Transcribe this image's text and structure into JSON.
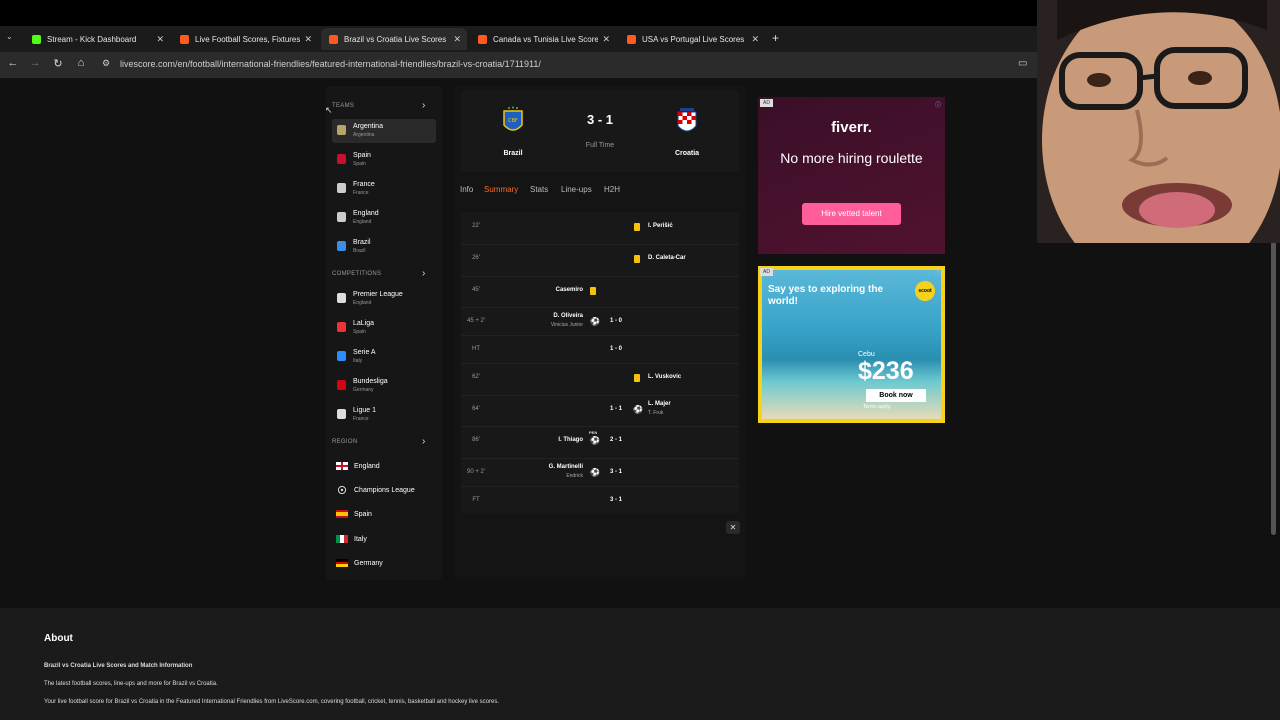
{
  "browser": {
    "tabs": [
      {
        "title": "Stream - Kick Dashboard",
        "favicon_color": "#53fc18"
      },
      {
        "title": "Live Football Scores, Fixtures &",
        "favicon_color": "#ff5a1f"
      },
      {
        "title": "Brazil vs Croatia Live Scores | Li",
        "favicon_color": "#ff5a1f"
      },
      {
        "title": "Canada vs Tunisia Live Scores |",
        "favicon_color": "#ff5a1f"
      },
      {
        "title": "USA vs Portugal Live Scores | Li",
        "favicon_color": "#ff5a1f"
      }
    ],
    "active_tab": 2,
    "url": "livescore.com/en/football/international-friendlies/featured-international-friendlies/brazil-vs-croatia/1711911/"
  },
  "sidebar": {
    "teams_title": "TEAMS",
    "teams": [
      {
        "name": "Argentina",
        "sub": "Argentina",
        "color": "#b9a36b"
      },
      {
        "name": "Spain",
        "sub": "Spain",
        "color": "#c8102e"
      },
      {
        "name": "France",
        "sub": "France",
        "color": "#ccc"
      },
      {
        "name": "England",
        "sub": "England",
        "color": "#ccc"
      },
      {
        "name": "Brazil",
        "sub": "Brazil",
        "color": "#3a8ee6"
      }
    ],
    "competitions_title": "COMPETITIONS",
    "competitions": [
      {
        "name": "Premier League",
        "sub": "England",
        "color": "#ddd"
      },
      {
        "name": "LaLiga",
        "sub": "Spain",
        "color": "#ee3338"
      },
      {
        "name": "Serie A",
        "sub": "Italy",
        "color": "#2f8cff"
      },
      {
        "name": "Bundesliga",
        "sub": "Germany",
        "color": "#d20515"
      },
      {
        "name": "Ligue 1",
        "sub": "France",
        "color": "#ddd"
      }
    ],
    "region_title": "REGION",
    "regions": [
      {
        "name": "England"
      },
      {
        "name": "Champions League"
      },
      {
        "name": "Spain"
      },
      {
        "name": "Italy"
      },
      {
        "name": "Germany"
      }
    ]
  },
  "match": {
    "home": "Brazil",
    "away": "Croatia",
    "score": "3 - 1",
    "status": "Full Time",
    "tabs": [
      "Info",
      "Summary",
      "Stats",
      "Line-ups",
      "H2H"
    ],
    "active_tab": "Summary",
    "events": [
      {
        "min": "22'",
        "side": "away",
        "type": "yellow",
        "player": "I. Perišić",
        "sub": "",
        "score": ""
      },
      {
        "min": "26'",
        "side": "away",
        "type": "yellow",
        "player": "D. Caleta-Car",
        "sub": "",
        "score": ""
      },
      {
        "min": "45'",
        "side": "home",
        "type": "yellow",
        "player": "Casemiro",
        "sub": "",
        "score": ""
      },
      {
        "min": "45 + 2'",
        "side": "home",
        "type": "goal",
        "player": "D. Oliveira",
        "sub": "Vinicius Junior",
        "score": "1 - 0"
      },
      {
        "min": "HT",
        "side": "center",
        "type": "period",
        "player": "",
        "sub": "",
        "score": "1 - 0"
      },
      {
        "min": "62'",
        "side": "away",
        "type": "yellow",
        "player": "L. Vuskovic",
        "sub": "",
        "score": ""
      },
      {
        "min": "64'",
        "side": "away",
        "type": "goal",
        "player": "L. Majer",
        "sub": "T. Fruk",
        "score": "1 - 1"
      },
      {
        "min": "86'",
        "side": "home",
        "type": "pen",
        "player": "I. Thiago",
        "sub": "",
        "score": "2 - 1",
        "pen_label": "PEN"
      },
      {
        "min": "90 + 2'",
        "side": "home",
        "type": "goal",
        "player": "G. Martinelli",
        "sub": "Endrick",
        "score": "3 - 1"
      },
      {
        "min": "FT",
        "side": "center",
        "type": "period",
        "player": "",
        "sub": "",
        "score": "3 - 1"
      }
    ]
  },
  "ads": {
    "badge": "AD",
    "fiverr": {
      "logo": "fiverr.",
      "headline": "No more hiring roulette",
      "cta": "Hire vetted talent"
    },
    "scoot": {
      "headline": "Say yes to exploring the world!",
      "logo": "scoot",
      "city": "Cebu",
      "price": "$236",
      "cta": "Book now",
      "terms": "Terms apply."
    }
  },
  "about": {
    "title": "About",
    "heading": "Brazil vs Croatia Live Scores and Match Information",
    "line1": "The latest football scores, line-ups and more for Brazil vs Croatia.",
    "line2": "Your live football score for Brazil vs Croatia in the Featured International Friendlies from LiveScore.com, covering football, cricket, tennis, basketball and hockey live scores."
  }
}
